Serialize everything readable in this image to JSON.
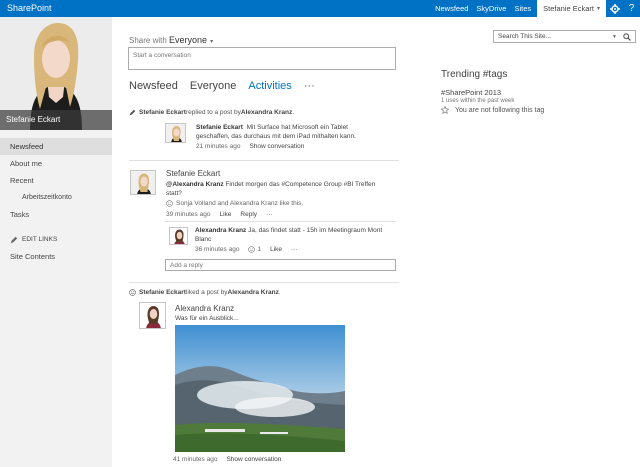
{
  "suite": {
    "brand": "SharePoint",
    "links": [
      "Newsfeed",
      "SkyDrive",
      "Sites"
    ],
    "user": "Stefanie Eckart"
  },
  "left": {
    "profile_name": "Stefanie Eckart",
    "nav": {
      "newsfeed": "Newsfeed",
      "about": "About me",
      "recent": "Recent",
      "arbeitszeitkonto": "Arbeitszeitkonto",
      "tasks": "Tasks",
      "edit_links": "EDIT LINKS",
      "site_contents": "Site Contents"
    }
  },
  "share": {
    "prefix": "Share with",
    "audience": "Everyone",
    "placeholder": "Start a conversation"
  },
  "tabs": {
    "newsfeed": "Newsfeed",
    "everyone": "Everyone",
    "activities": "Activities",
    "more": "···"
  },
  "search": {
    "placeholder": "Search This Site..."
  },
  "trending": {
    "title": "Trending #tags",
    "tag": "#SharePoint 2013",
    "uses": "1 uses within the past week",
    "follow": "You are not following this tag"
  },
  "feed": {
    "entry1": {
      "actor": "Stefanie Eckart",
      "action": " replied to a post by ",
      "target": "Alexandra Kranz",
      "end": ".",
      "author": "Stefanie Eckart",
      "text_line1": "Mit Surface hat Microsoft ein Tablet",
      "text_line2": "geschaffen, das durchaus mit dem iPad mithalten kann.",
      "time": "21 minutes ago",
      "show": "Show conversation"
    },
    "post2": {
      "author": "Stefanie Eckart",
      "mention": "@Alexandra Kranz",
      "text_line1": " Findet morgen das #Competence Group #BI Treffen",
      "text_line2": "statt?",
      "likes": "Sonja Volland and Alexandra Kranz like this.",
      "time": "39 minutes ago",
      "like": "Like",
      "reply": "Reply",
      "more": "···",
      "reply_author": "Alexandra Kranz",
      "reply_text_line1": " Ja, das findet statt - 15h im Meetingraum Mont",
      "reply_text_line2": "Blanc",
      "reply_time": "36 minutes ago",
      "reply_likes": "1",
      "reply_like": "Like",
      "reply_more": "···",
      "add_reply": "Add a reply"
    },
    "entry3": {
      "actor": "Stefanie Eckart",
      "action": " liked a post by ",
      "target": "Alexandra Kranz",
      "end": ".",
      "author": "Alexandra Kranz",
      "text": "Was für ein Ausblick...",
      "time": "41 minutes ago",
      "show": "Show conversation"
    }
  }
}
